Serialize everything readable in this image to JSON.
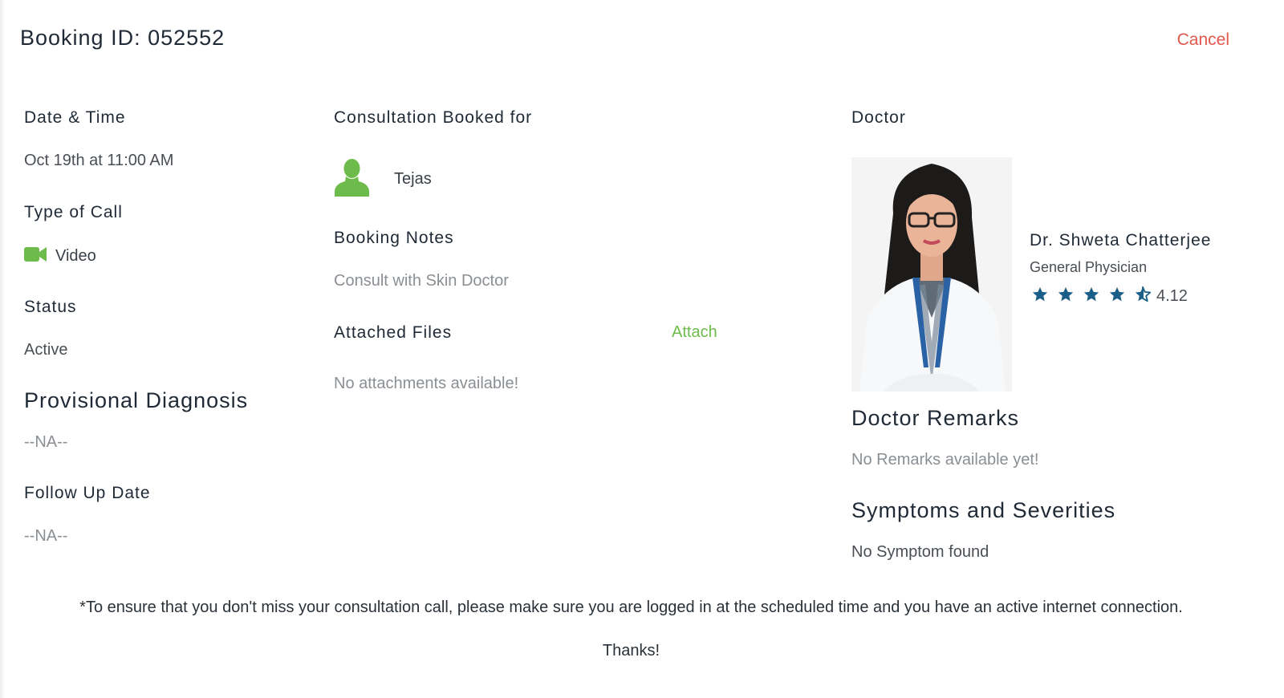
{
  "header": {
    "title": "Booking ID: 052552",
    "cancel_label": "Cancel"
  },
  "left": {
    "date_label": "Date & Time",
    "date_value": "Oct 19th at 11:00 AM",
    "call_type_label": "Type of Call",
    "call_type_value": "Video",
    "status_label": "Status",
    "status_value": "Active",
    "diagnosis_label": "Provisional Diagnosis",
    "diagnosis_value": "--NA--",
    "followup_label": "Follow Up Date",
    "followup_value": "--NA--"
  },
  "middle": {
    "booked_for_label": "Consultation Booked for",
    "patient_name": "Tejas",
    "notes_label": "Booking Notes",
    "notes_value": "Consult with Skin Doctor",
    "files_label": "Attached Files",
    "attach_label": "Attach",
    "no_files": "No attachments available!"
  },
  "right": {
    "doctor_label": "Doctor",
    "doctor_name": "Dr. Shweta Chatterjee",
    "doctor_specialty": "General Physician",
    "rating": "4.12",
    "rating_stars": 4.5,
    "remarks_label": "Doctor Remarks",
    "remarks_value": "No Remarks available yet!",
    "symptoms_label": "Symptoms and Severities",
    "symptoms_value": "No Symptom found"
  },
  "footer": {
    "note": "*To ensure that you don't miss your consultation call, please make sure you are logged in at the scheduled time and you have an active internet connection.",
    "thanks": "Thanks!"
  },
  "colors": {
    "accent_green": "#6dbb4a",
    "cancel_red": "#e2574c",
    "star_blue": "#1b5e86"
  },
  "icons": {
    "call_type": "video-camera-icon",
    "patient": "person-icon",
    "rating": "star-icon"
  }
}
